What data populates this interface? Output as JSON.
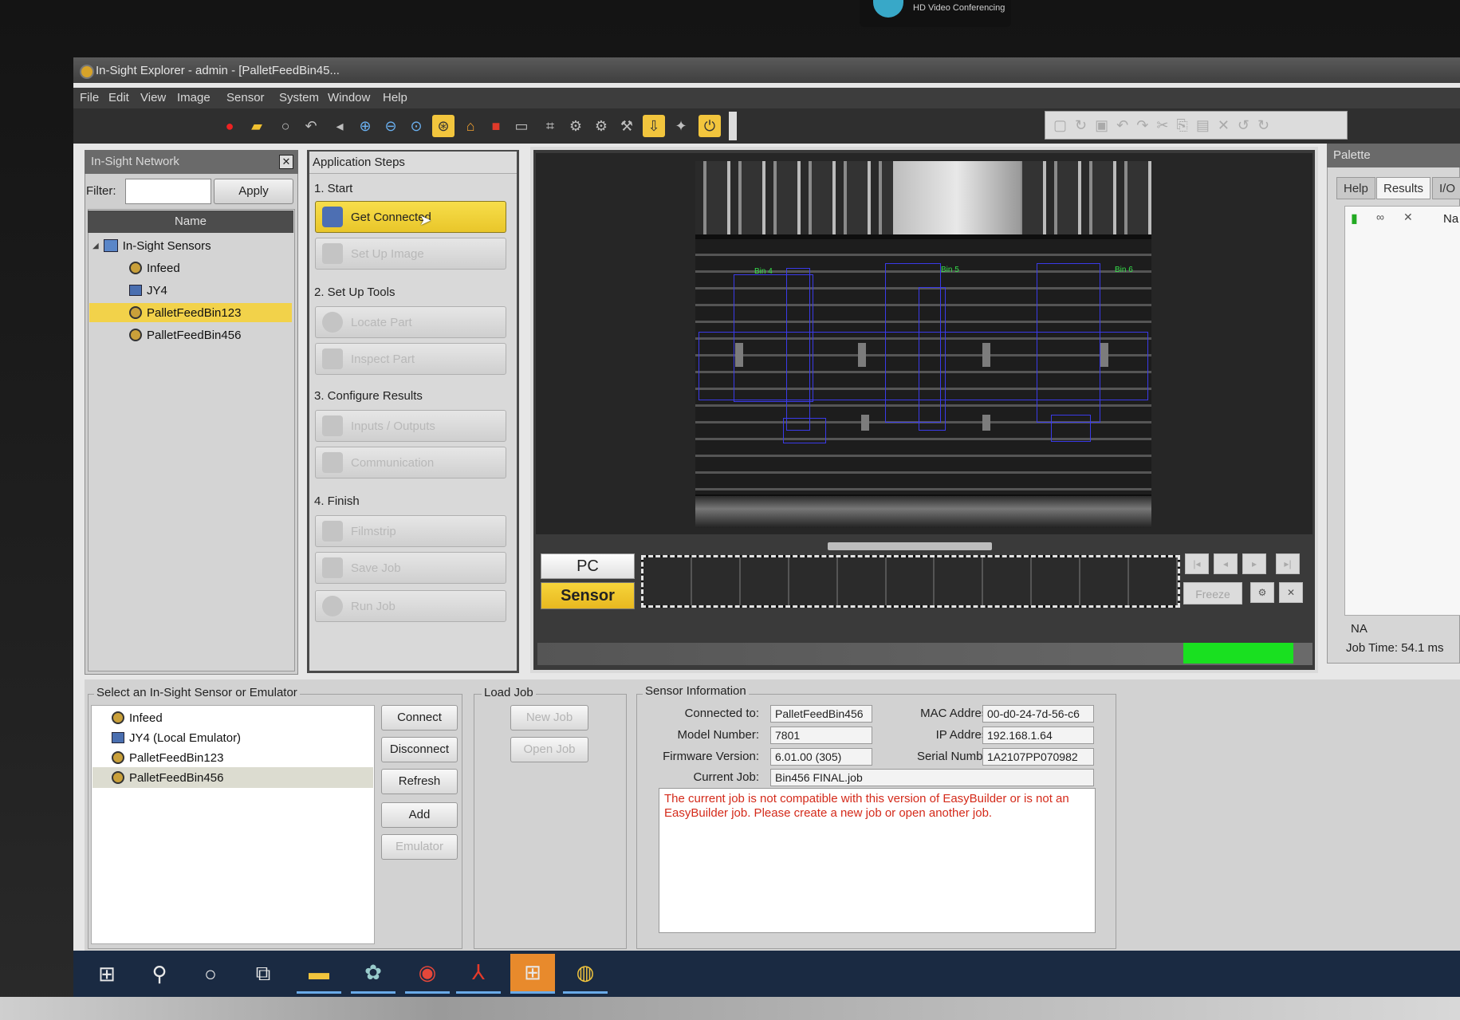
{
  "webcam_text": "HD Video Conferencing",
  "window": {
    "title": "In-Sight Explorer - admin - [PalletFeedBin45..."
  },
  "menu": [
    "File",
    "Edit",
    "View",
    "Image",
    "Sensor",
    "System",
    "Window",
    "Help"
  ],
  "network": {
    "title": "In-Sight Network",
    "filter_label": "Filter:",
    "filter_value": "",
    "apply": "Apply",
    "column": "Name",
    "root": "In-Sight Sensors",
    "items": [
      "Infeed",
      "JY4",
      "PalletFeedBin123",
      "PalletFeedBin456"
    ],
    "selected": "PalletFeedBin123"
  },
  "steps": {
    "title": "Application Steps",
    "sections": [
      "1. Start",
      "2. Set Up Tools",
      "3. Configure Results",
      "4. Finish"
    ],
    "buttons": [
      "Get Connected",
      "Set Up Image",
      "Locate Part",
      "Inspect Part",
      "Inputs / Outputs",
      "Communication",
      "Filmstrip",
      "Save Job",
      "Run Job"
    ],
    "active": "Get Connected"
  },
  "image": {
    "roi_labels": [
      "Bin 4",
      "Bin 5",
      "Bin 6"
    ],
    "pc_label": "PC",
    "sensor_label": "Sensor",
    "freeze_label": "Freeze"
  },
  "palette": {
    "title": "Palette",
    "tabs": [
      "Help",
      "Results",
      "I/O"
    ],
    "active_tab": "Results",
    "column_partial": "Na",
    "na": "NA",
    "job_time": "Job Time: 54.1 ms"
  },
  "select_sensor": {
    "title": "Select an In-Sight Sensor or Emulator",
    "items": [
      "Infeed",
      "JY4 (Local Emulator)",
      "PalletFeedBin123",
      "PalletFeedBin456"
    ],
    "selected": "PalletFeedBin456",
    "buttons": [
      "Connect",
      "Disconnect",
      "Refresh",
      "Add",
      "Emulator"
    ]
  },
  "load_job": {
    "title": "Load Job",
    "new_job": "New Job",
    "open_job": "Open Job"
  },
  "sensor_info": {
    "title": "Sensor Information",
    "connected_to_label": "Connected to:",
    "connected_to": "PalletFeedBin456",
    "model_label": "Model Number:",
    "model": "7801",
    "firmware_label": "Firmware Version:",
    "firmware": "6.01.00 (305)",
    "current_job_label": "Current Job:",
    "current_job": "Bin456 FINAL.job",
    "mac_label": "MAC Address:",
    "mac": "00-d0-24-7d-56-c6",
    "ip_label": "IP Address:",
    "ip": "192.168.1.64",
    "serial_label": "Serial Number:",
    "serial": "1A2107PP070982",
    "message": "The current job is not compatible with this version of EasyBuilder or is not an EasyBuilder job.  Please create a new job or open another job."
  },
  "colors": {
    "accent_yellow": "#f2c53d",
    "status_green": "#19e020",
    "error_red": "#d42a1a"
  }
}
